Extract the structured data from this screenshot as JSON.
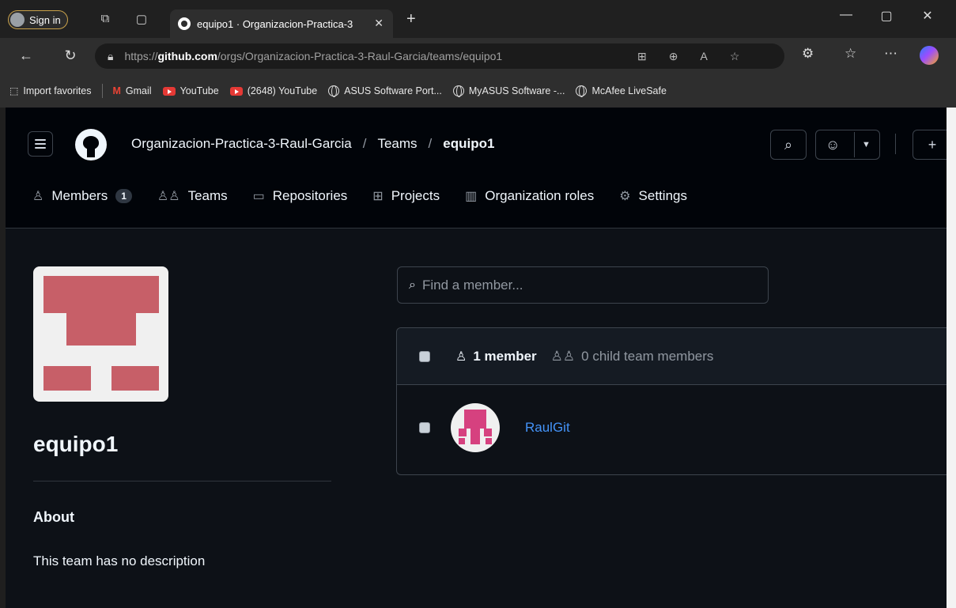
{
  "browser": {
    "signin_label": "Sign in",
    "tab_title": "equipo1 · Organizacion-Practica-3",
    "url_prefix": "https://",
    "url_domain": "github.com",
    "url_path": "/orgs/Organizacion-Practica-3-Raul-Garcia/teams/equipo1",
    "bookmarks": [
      {
        "label": "Import favorites",
        "icon": "import-icon"
      },
      {
        "label": "Gmail",
        "icon": "gmail-icon"
      },
      {
        "label": "YouTube",
        "icon": "youtube-icon"
      },
      {
        "label": "(2648) YouTube",
        "icon": "youtube-icon"
      },
      {
        "label": "ASUS Software Port...",
        "icon": "globe-icon"
      },
      {
        "label": "MyASUS Software -...",
        "icon": "globe-icon"
      },
      {
        "label": "McAfee LiveSafe",
        "icon": "globe-icon"
      }
    ]
  },
  "header": {
    "breadcrumb": {
      "org": "Organizacion-Practica-3-Raul-Garcia",
      "section": "Teams",
      "current": "equipo1"
    }
  },
  "nav": {
    "members_label": "Members",
    "members_count": "1",
    "teams_label": "Teams",
    "repositories_label": "Repositories",
    "projects_label": "Projects",
    "org_roles_label": "Organization roles",
    "settings_label": "Settings"
  },
  "team": {
    "name": "equipo1",
    "about_heading": "About",
    "description": "This team has no description"
  },
  "members": {
    "search_placeholder": "Find a member...",
    "count_label": "1 member",
    "child_label": "0 child team members",
    "list": [
      {
        "username": "RaulGit"
      }
    ]
  },
  "colors": {
    "page_bg": "#0d1117",
    "header_bg": "#010409",
    "link": "#4493f8",
    "team_avatar": "#c75f68",
    "user_avatar": "#d6417f"
  }
}
